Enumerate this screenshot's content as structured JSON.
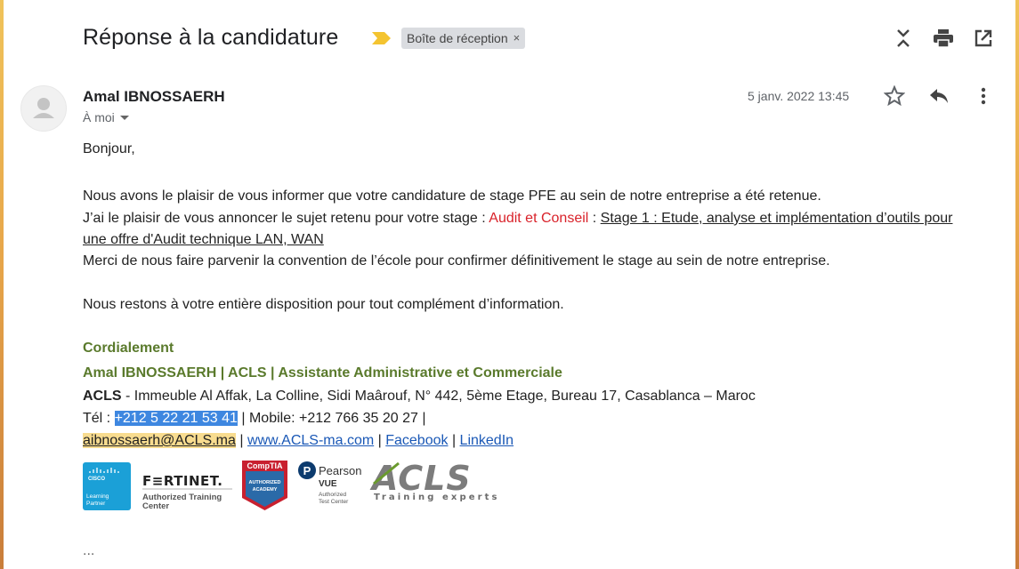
{
  "subject": "Réponse à la candidature",
  "label": {
    "text": "Boîte de réception",
    "remove": "×"
  },
  "sender": {
    "name": "Amal IBNOSSAERH",
    "to": "À moi",
    "date": "5 janv. 2022 13:45"
  },
  "body": {
    "greeting": "Bonjour,",
    "p1": "Nous avons le plaisir de vous informer que votre candidature de stage PFE au sein de notre entreprise a été retenue.",
    "p2_intro": "J’ai le plaisir de vous annoncer le sujet retenu pour votre stage :  ",
    "p2_red": "Audit et Conseil",
    "p2_sep": " : ",
    "p2_link1": "Stage 1 : Etude, analyse et implémentation d’outils pour",
    "p2_link2": "une offre d'Audit technique LAN, WAN",
    "p3": "Merci de nous faire parvenir la convention de l’école pour confirmer définitivement le stage au sein de notre entreprise.",
    "p4": "Nous restons à votre entière disposition pour tout complément d’information."
  },
  "signature": {
    "closing": "Cordialement",
    "line1": "Amal IBNOSSAERH | ACLS | Assistante Administrative et Commerciale",
    "company": "ACLS",
    "address": " - Immeuble Al Affak, La Colline, Sidi Maârouf, N° 442, 5ème Etage, Bureau 17, Casablanca – Maroc",
    "tel_label": "Tél : ",
    "tel": "+212 5 22 21 53 41",
    "mobile": " | Mobile: +212 766 35 20 27 |",
    "email": "aibnossaerh@ACLS.ma",
    "sep": " | ",
    "website": "www.ACLS-ma.com",
    "facebook": "Facebook",
    "linkedin": "LinkedIn"
  },
  "logos": {
    "cisco": {
      "brand": "CISCO",
      "line1": "Learning",
      "line2": "Partner"
    },
    "fortinet": {
      "brand": "F≡RTINET.",
      "line1": "Authorized Training",
      "line2": "Center"
    },
    "comptia": {
      "brand": "CompTIA",
      "line1": "AUTHORIZED",
      "line2": "ACADEMY"
    },
    "pearson": {
      "brand": "Pearson",
      "sub": "VUE",
      "line1": "Authorized",
      "line2": "Test Center"
    },
    "acls": {
      "brand": "ACLS",
      "tagline": "Training experts"
    }
  },
  "ellipsis": "...",
  "colors": {
    "accent_green": "#5a7a2c",
    "link_blue": "#1a58b6",
    "selection": "#3e87e0",
    "highlight": "#f8dc8f",
    "red": "#d9222a"
  }
}
